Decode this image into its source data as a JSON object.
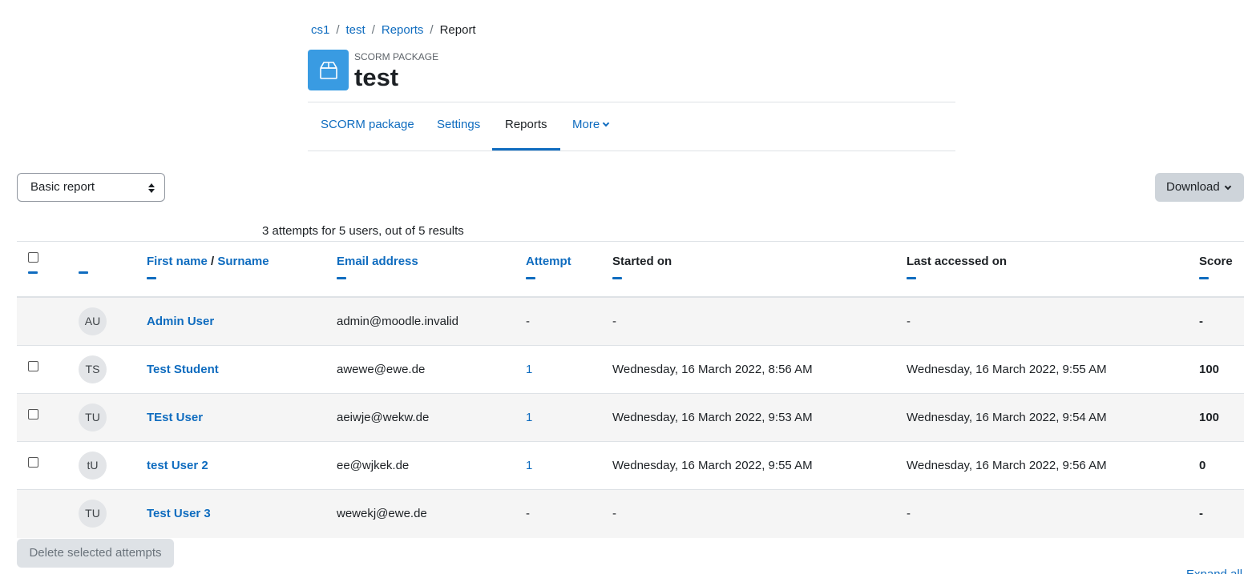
{
  "breadcrumb": {
    "items": [
      "cs1",
      "test",
      "Reports"
    ],
    "current": "Report",
    "separator": "/"
  },
  "activity": {
    "icon": "package-box-icon",
    "type_label": "SCORM PACKAGE",
    "title": "test"
  },
  "nav": {
    "tabs": [
      {
        "label": "SCORM package",
        "active": false
      },
      {
        "label": "Settings",
        "active": false
      },
      {
        "label": "Reports",
        "active": true
      },
      {
        "label": "More",
        "active": false
      }
    ]
  },
  "report_select": {
    "value": "Basic report"
  },
  "download_button": {
    "label": "Download"
  },
  "summary": "3 attempts for 5 users, out of 5 results",
  "table": {
    "headers": {
      "first_name": "First name",
      "name_sep": " / ",
      "surname": "Surname",
      "email": "Email address",
      "attempt": "Attempt",
      "started": "Started on",
      "last_accessed": "Last accessed on",
      "score": "Score"
    },
    "rows": [
      {
        "initials": "AU",
        "name": "Admin User",
        "email": "admin@moodle.invalid",
        "attempt": "-",
        "started": "-",
        "last_accessed": "-",
        "score": "-",
        "has_checkbox": false
      },
      {
        "initials": "TS",
        "name": "Test Student",
        "email": "awewe@ewe.de",
        "attempt": "1",
        "started": "Wednesday, 16 March 2022, 8:56 AM",
        "last_accessed": "Wednesday, 16 March 2022, 9:55 AM",
        "score": "100",
        "has_checkbox": true
      },
      {
        "initials": "TU",
        "name": "TEst User",
        "email": "aeiwje@wekw.de",
        "attempt": "1",
        "started": "Wednesday, 16 March 2022, 9:53 AM",
        "last_accessed": "Wednesday, 16 March 2022, 9:54 AM",
        "score": "100",
        "has_checkbox": true
      },
      {
        "initials": "tU",
        "name": "test User 2",
        "email": "ee@wjkek.de",
        "attempt": "1",
        "started": "Wednesday, 16 March 2022, 9:55 AM",
        "last_accessed": "Wednesday, 16 March 2022, 9:56 AM",
        "score": "0",
        "has_checkbox": true
      },
      {
        "initials": "TU",
        "name": "Test User 3",
        "email": "wewekj@ewe.de",
        "attempt": "-",
        "started": "-",
        "last_accessed": "-",
        "score": "-",
        "has_checkbox": false
      }
    ]
  },
  "delete_button": {
    "label": "Delete selected attempts"
  },
  "expand_all": "Expand all",
  "colors": {
    "link": "#0f6cbf",
    "icon_bg": "#399be2",
    "stripe": "#f5f5f5"
  }
}
